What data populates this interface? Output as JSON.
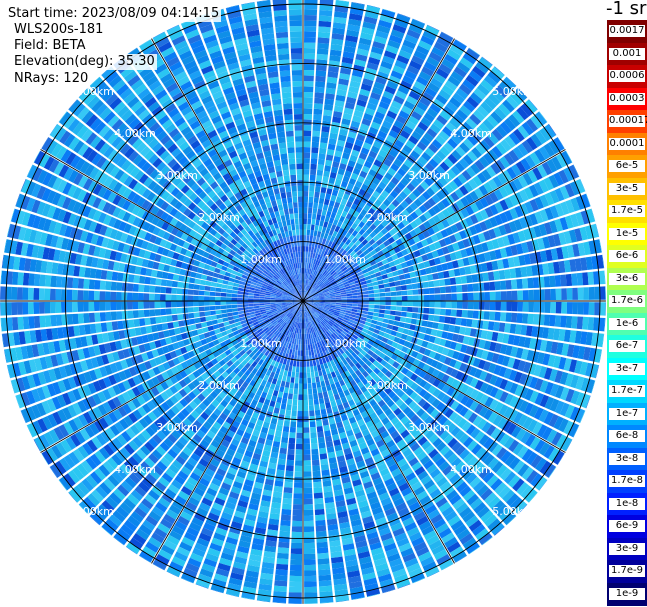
{
  "info": {
    "start_time": "Start time: 2023/08/09 04:14:15",
    "device": "WLS200s-181",
    "field": "Field: BETA",
    "elevation": "Elevation(deg): 35.30",
    "nrays": "NRays: 120"
  },
  "colorbar": {
    "units": "-1 sr",
    "labels": [
      "0.0017",
      "0.001",
      "0.0006",
      "0.0003",
      "0.00017",
      "0.0001",
      "6e-5",
      "3e-5",
      "1.7e-5",
      "1e-5",
      "6e-6",
      "3e-6",
      "1.7e-6",
      "1e-6",
      "6e-7",
      "3e-7",
      "1.7e-7",
      "1e-7",
      "6e-8",
      "3e-8",
      "1.7e-8",
      "1e-8",
      "6e-9",
      "3e-9",
      "1.7e-9",
      "1e-9"
    ],
    "colors": [
      "#800000",
      "#a00000",
      "#c80000",
      "#ff0000",
      "#ff4000",
      "#ff8000",
      "#ffa000",
      "#ffc000",
      "#ffe000",
      "#ffff00",
      "#e0ff20",
      "#b0ff50",
      "#80ff80",
      "#50ffb0",
      "#20ffe0",
      "#00ffff",
      "#00d8ff",
      "#00b0ff",
      "#0088ff",
      "#0060ff",
      "#0040ff",
      "#0020ff",
      "#0000e0",
      "#0000c0",
      "#00009a",
      "#000070"
    ]
  },
  "chart_data": {
    "type": "heatmap",
    "projection": "polar (PPI scan)",
    "nrays": 120,
    "range_rings_km": [
      1,
      2,
      3,
      4,
      5
    ],
    "ring_labels": [
      "1.00km",
      "2.00km",
      "3.00km",
      "4.00km",
      "5.00km"
    ],
    "max_range_km": 5.1,
    "spoke_angles_deg": [
      0,
      30,
      60,
      90,
      120,
      150,
      180,
      210,
      240,
      270,
      300,
      330
    ],
    "value_scale": "log",
    "value_range": [
      1e-09,
      0.0017
    ],
    "dominant_values": {
      "inner_region_0_to_1km": "1.7e-8",
      "outer_region_1_to_5km": "1e-7 to 1.7e-7"
    },
    "grid": true
  }
}
